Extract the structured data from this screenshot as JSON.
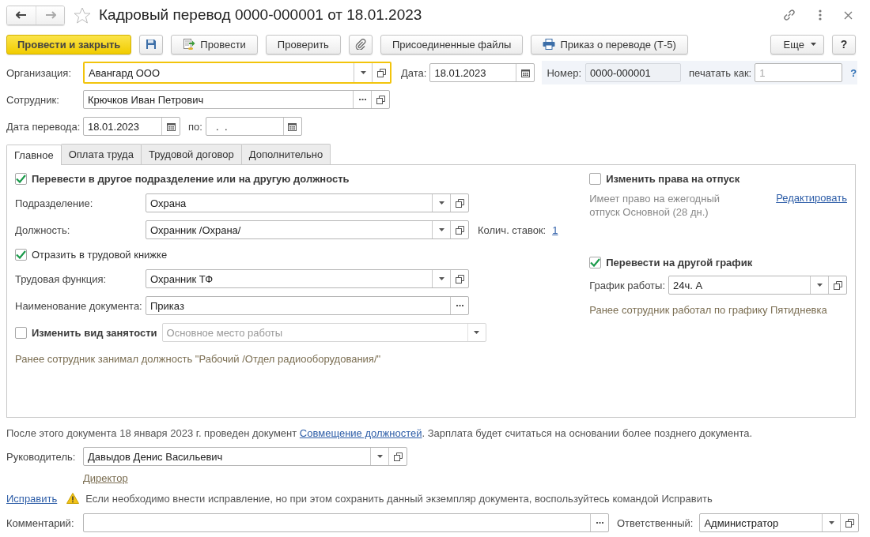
{
  "window": {
    "title": "Кадровый перевод 0000-000001 от 18.01.2023"
  },
  "toolbar": [
    {
      "kind": "primary",
      "label": "Провести и закрыть"
    },
    {
      "kind": "save"
    },
    {
      "kind": "post",
      "label": "Провести"
    },
    {
      "kind": "text",
      "label": "Проверить"
    },
    {
      "kind": "attach"
    },
    {
      "kind": "text",
      "label": "Присоединенные файлы"
    },
    {
      "kind": "print",
      "label": "Приказ о переводе (Т-5)"
    },
    {
      "kind": "more",
      "label": "Еще"
    },
    {
      "kind": "help",
      "label": "?"
    }
  ],
  "header": {
    "organization": {
      "label": "Организация:",
      "value": "Авангард ООО",
      "kind": "select",
      "focused": true
    },
    "date": {
      "label": "Дата:",
      "value": "18.01.2023",
      "kind": "date"
    },
    "number": {
      "label": "Номер:",
      "value": "0000-000001",
      "readonly": true
    },
    "print_as": {
      "label": "печатать как:",
      "placeholder": "1"
    },
    "help": "?",
    "employee": {
      "label": "Сотрудник:",
      "value": "Крючков Иван Петрович",
      "kind": "choose"
    },
    "transfer_date": {
      "label": "Дата перевода:",
      "value": "18.01.2023",
      "kind": "date"
    },
    "until": {
      "label": "по:",
      "value": "  .  .",
      "kind": "date"
    }
  },
  "tabs": [
    {
      "label": "Главное",
      "selected": true
    },
    {
      "label": "Оплата труда",
      "selected": false
    },
    {
      "label": "Трудовой договор",
      "selected": false
    },
    {
      "label": "Дополнительно",
      "selected": false
    }
  ],
  "main": {
    "left": [
      {
        "kind": "section",
        "label": "Перевести в другое подразделение или на другую должность",
        "checked": true
      },
      {
        "kind": "field",
        "label": "Подразделение:",
        "input": {
          "kind": "select",
          "value": "Охрана"
        }
      },
      {
        "kind": "field",
        "label": "Должность:",
        "input": {
          "kind": "select",
          "value": "Охранник /Охрана/"
        },
        "extra_label": "Колич. ставок:",
        "extra_link": "1"
      },
      {
        "kind": "check",
        "label": "Отразить в трудовой книжке",
        "checked": true
      },
      {
        "kind": "field",
        "label": "Трудовая функция:",
        "input": {
          "kind": "select",
          "value": "Охранник ТФ"
        }
      },
      {
        "kind": "field",
        "label": "Наименование документа:",
        "input": {
          "kind": "pick",
          "value": "Приказ"
        }
      },
      {
        "kind": "check_field",
        "label": "Изменить вид занятости",
        "checked": false,
        "input": {
          "kind": "dropdown",
          "value": "Основное место работы",
          "disabled": true
        }
      },
      {
        "kind": "note",
        "text": "Ранее сотрудник занимал должность \"Рабочий /Отдел радиооборудования/\""
      }
    ],
    "right": [
      {
        "kind": "section",
        "label": "Изменить права на отпуск",
        "checked": false
      },
      {
        "kind": "info",
        "text": "Имеет право на ежегодный отпуск Основной (28 дн.)",
        "link": "Редактировать"
      },
      {
        "kind": "section",
        "label": "Перевести на другой график",
        "checked": true
      },
      {
        "kind": "field",
        "label": "График работы:",
        "input": {
          "kind": "select",
          "value": "24ч. А"
        }
      },
      {
        "kind": "note",
        "text": "Ранее сотрудник работал по графику Пятидневка"
      }
    ]
  },
  "footer": {
    "notice": {
      "before": "После этого документа 18 января 2023 г. проведен документ ",
      "link": "Совмещение должностей",
      "after": ". Зарплата будет считаться на основании более позднего документа."
    },
    "manager": {
      "label": "Руководитель:",
      "value": "Давыдов Денис Васильевич",
      "kind": "select"
    },
    "manager_position": "Директор",
    "fix_link": "Исправить",
    "warning": "Если необходимо внести исправление, но при этом сохранить данный экземпляр документа, воспользуйтесь командой Исправить",
    "comment": {
      "label": "Комментарий:",
      "kind": "pick"
    },
    "responsible": {
      "label": "Ответственный:",
      "value": "Администратор",
      "kind": "select"
    }
  }
}
